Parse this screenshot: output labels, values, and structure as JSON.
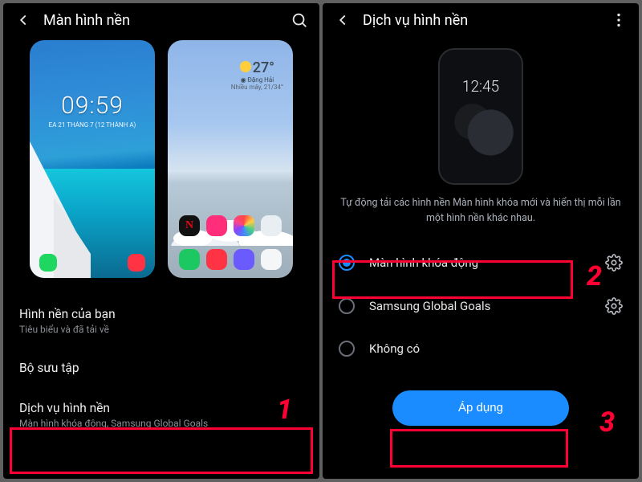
{
  "left": {
    "title": "Màn hình nền",
    "lock_time": "09:59",
    "lock_date": "EA 21 THÁNG 7 (12 THÀNH A)",
    "weather_temp": "27°",
    "weather_loc": "◉ Đặng Hải",
    "weather_range": "Nhiều mây, 21/34°",
    "items": [
      {
        "title": "Hình nền của bạn",
        "sub": "Tiêu biểu và đã tải về"
      },
      {
        "title": "Bộ sưu tập",
        "sub": ""
      },
      {
        "title": "Dịch vụ hình nền",
        "sub": "Màn hình khóa động, Samsung Global Goals"
      }
    ]
  },
  "right": {
    "title": "Dịch vụ hình nền",
    "mini_time": "12:45",
    "desc": "Tự động tải các hình nền Màn hình khóa mới và hiển thị mỗi lần một hình nền khác nhau.",
    "options": [
      {
        "label": "Màn hình khóa động",
        "selected": true,
        "gear": true
      },
      {
        "label": "Samsung Global Goals",
        "selected": false,
        "gear": true
      },
      {
        "label": "Không có",
        "selected": false,
        "gear": false
      }
    ],
    "apply": "Áp dụng"
  },
  "anno": {
    "n1": "1",
    "n2": "2",
    "n3": "3"
  }
}
